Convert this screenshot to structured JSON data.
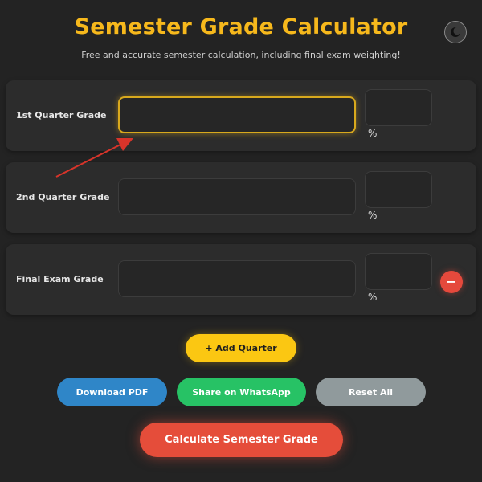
{
  "header": {
    "title": "Semester Grade Calculator",
    "subtitle": "Free and accurate semester calculation, including final exam weighting!"
  },
  "theme_toggle": {
    "icon": "moon-icon"
  },
  "rows": [
    {
      "label": "1st Quarter Grade",
      "grade_value": "",
      "weight_value": "",
      "percent_label": "%",
      "focused": true,
      "removable": false
    },
    {
      "label": "2nd Quarter Grade",
      "grade_value": "",
      "weight_value": "",
      "percent_label": "%",
      "focused": false,
      "removable": false
    },
    {
      "label": "Final Exam Grade",
      "grade_value": "",
      "weight_value": "",
      "percent_label": "%",
      "focused": false,
      "removable": true
    }
  ],
  "remove_label": "−",
  "actions": {
    "add_quarter": "+ Add Quarter",
    "download_pdf": "Download PDF",
    "share_whatsapp": "Share on WhatsApp",
    "reset_all": "Reset All",
    "calculate": "Calculate Semester Grade"
  },
  "colors": {
    "title": "#f6b81c",
    "add": "#fbc712",
    "pdf": "#2f86c8",
    "whatsapp": "#27c265",
    "reset": "#909a9c",
    "calculate": "#e54d3a",
    "remove": "#e5493c",
    "annotation_arrow": "#d8342a"
  }
}
